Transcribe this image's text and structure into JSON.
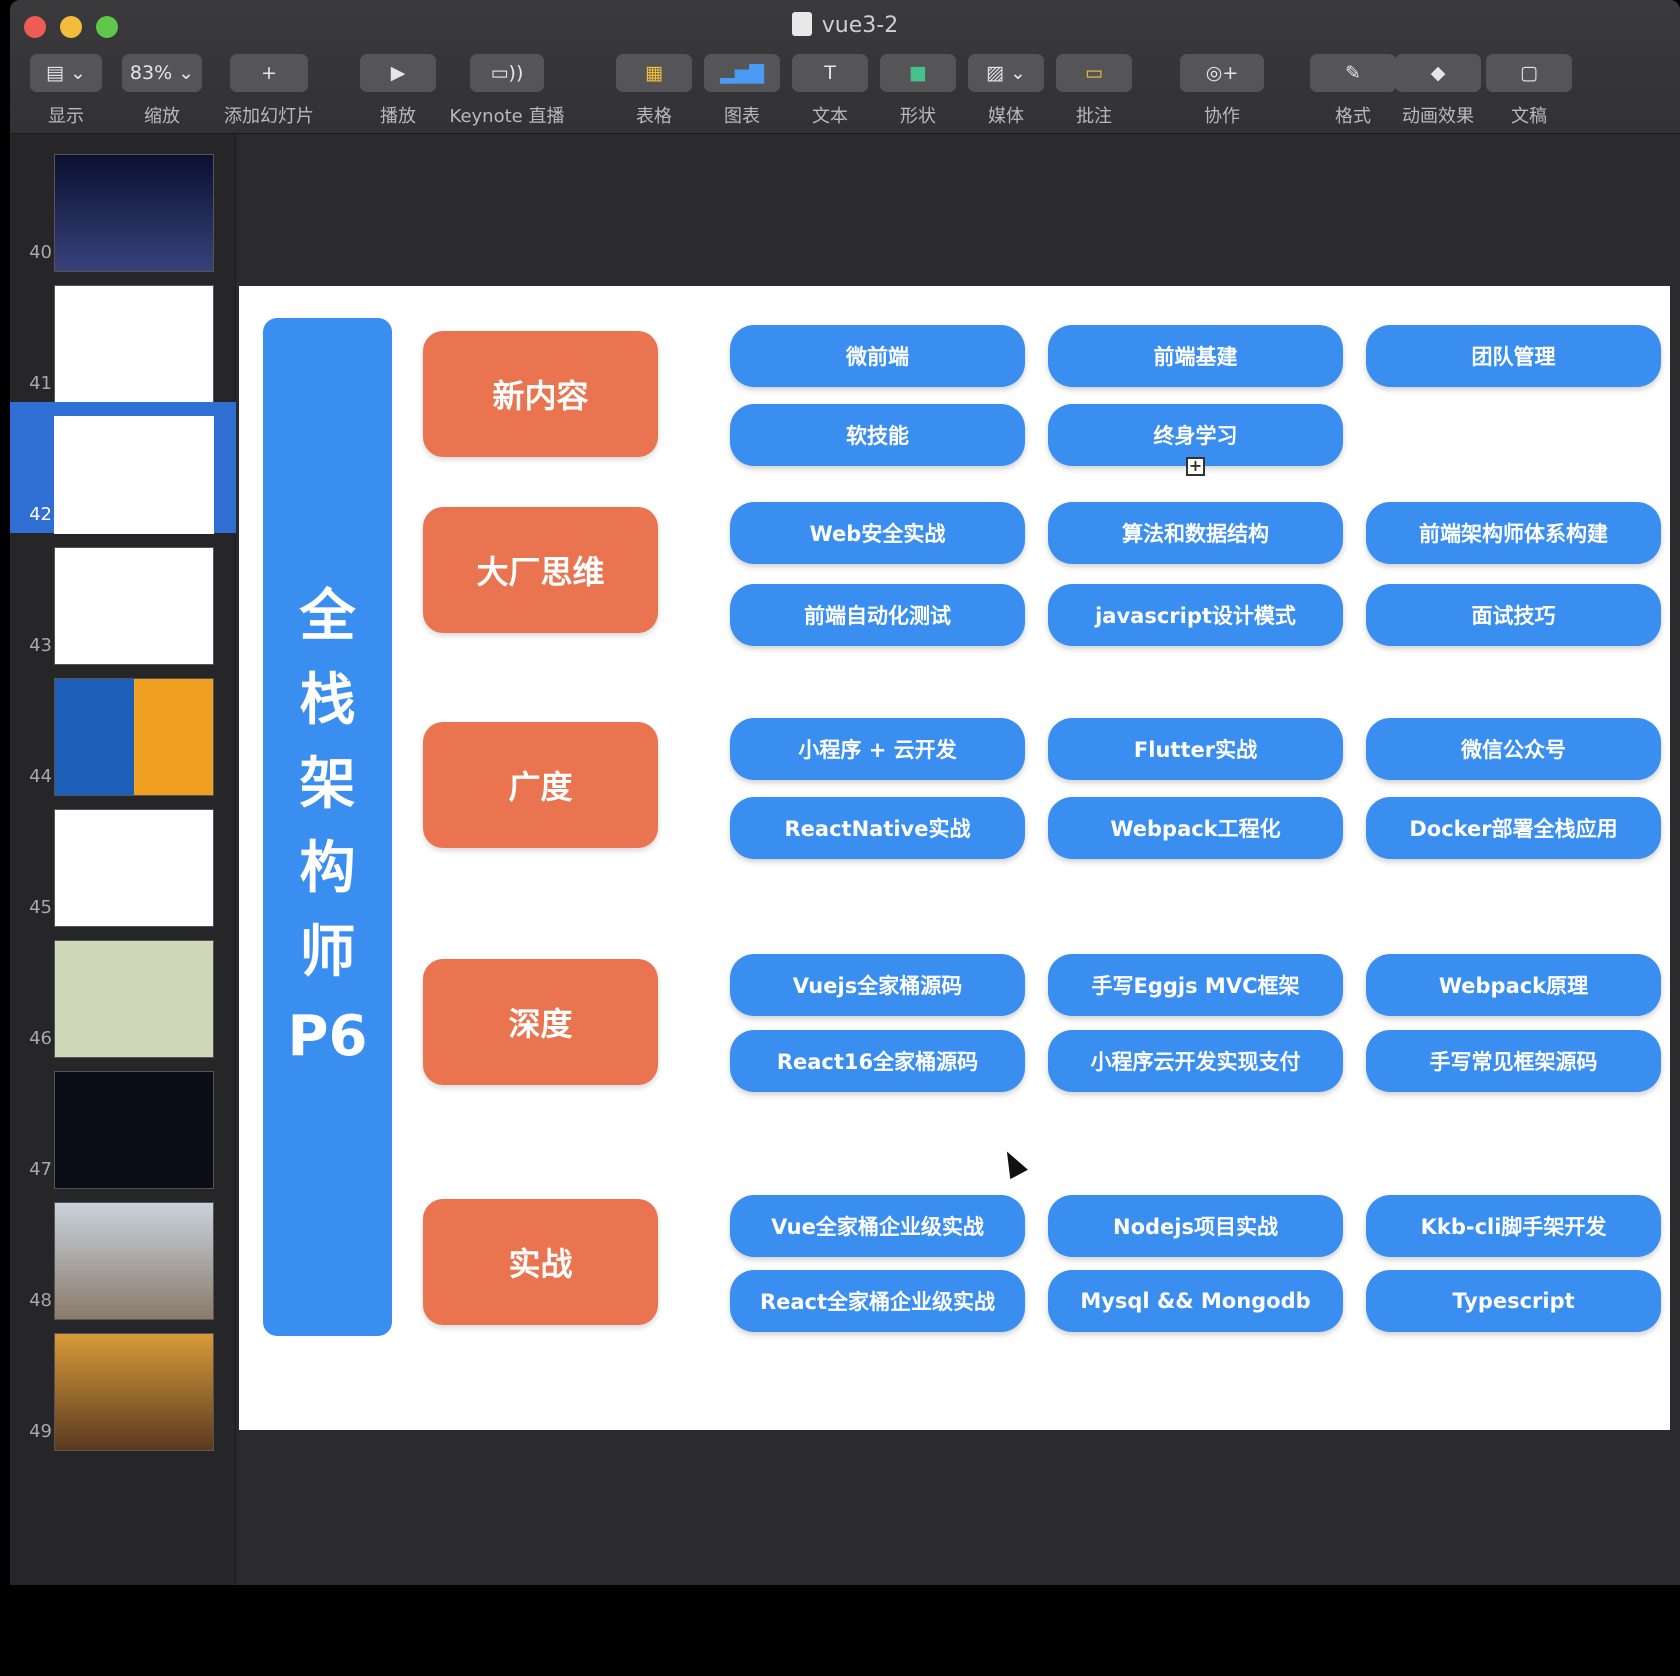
{
  "window": {
    "title": "vue3-2"
  },
  "toolbar": [
    {
      "id": "view",
      "icon": "view-icon",
      "glyph": "▤ ⌄",
      "label": "显示"
    },
    {
      "id": "zoom",
      "icon": "",
      "glyph": "83% ⌄",
      "label": "缩放"
    },
    {
      "id": "add-slide",
      "icon": "plus-icon",
      "glyph": "+",
      "label": "添加幻灯片"
    },
    {
      "id": "play",
      "icon": "play-icon",
      "glyph": "▶",
      "label": "播放"
    },
    {
      "id": "keynote-live",
      "icon": "live-icon",
      "glyph": "▭))",
      "label": "Keynote 直播"
    },
    {
      "id": "table",
      "icon": "table-icon",
      "glyph": "▦",
      "label": "表格"
    },
    {
      "id": "chart",
      "icon": "chart-icon",
      "glyph": "▂▅▇",
      "label": "图表"
    },
    {
      "id": "text",
      "icon": "text-icon",
      "glyph": "T",
      "label": "文本"
    },
    {
      "id": "shape",
      "icon": "shape-icon",
      "glyph": "■",
      "label": "形状"
    },
    {
      "id": "media",
      "icon": "media-icon",
      "glyph": "▨ ⌄",
      "label": "媒体"
    },
    {
      "id": "comment",
      "icon": "comment-icon",
      "glyph": "▭",
      "label": "批注"
    },
    {
      "id": "collaborate",
      "icon": "collaborate-icon",
      "glyph": "◎+",
      "label": "协作"
    },
    {
      "id": "format",
      "icon": "format-icon",
      "glyph": "✎",
      "label": "格式"
    },
    {
      "id": "animate",
      "icon": "animate-icon",
      "glyph": "◆",
      "label": "动画效果"
    },
    {
      "id": "document",
      "icon": "document-icon",
      "glyph": "▢",
      "label": "文稿"
    }
  ],
  "slides": [
    {
      "num": "40"
    },
    {
      "num": "41"
    },
    {
      "num": "42",
      "selected": true
    },
    {
      "num": "43"
    },
    {
      "num": "44"
    },
    {
      "num": "45"
    },
    {
      "num": "46"
    },
    {
      "num": "47"
    },
    {
      "num": "48"
    },
    {
      "num": "49"
    }
  ],
  "slide": {
    "main_title": [
      "全",
      "栈",
      "架",
      "构",
      "师",
      "P6"
    ],
    "categories": [
      "新内容",
      "大厂思维",
      "广度",
      "深度",
      "实战"
    ],
    "pills": [
      [
        "微前端",
        "前端基建",
        "团队管理",
        "软技能",
        "终身学习"
      ],
      [
        "Web安全实战",
        "算法和数据结构",
        "前端架构师体系构建",
        "前端自动化测试",
        "javascript设计模式",
        "面试技巧"
      ],
      [
        "小程序 + 云开发",
        "Flutter实战",
        "微信公众号",
        "ReactNative实战",
        "Webpack工程化",
        "Docker部署全栈应用"
      ],
      [
        "Vuejs全家桶源码",
        "手写Eggjs MVC框架",
        "Webpack原理",
        "React16全家桶源码",
        "小程序云开发实现支付",
        "手写常见框架源码"
      ],
      [
        "Vue全家桶企业级实战",
        "Nodejs项目实战",
        "Kkb-cli脚手架开发",
        "React全家桶企业级实战",
        "Mysql && Mongodb",
        "Typescript"
      ]
    ]
  },
  "colors": {
    "blue": "#3a8ef0",
    "orange": "#ea7450",
    "selection": "#2f6fd3"
  }
}
